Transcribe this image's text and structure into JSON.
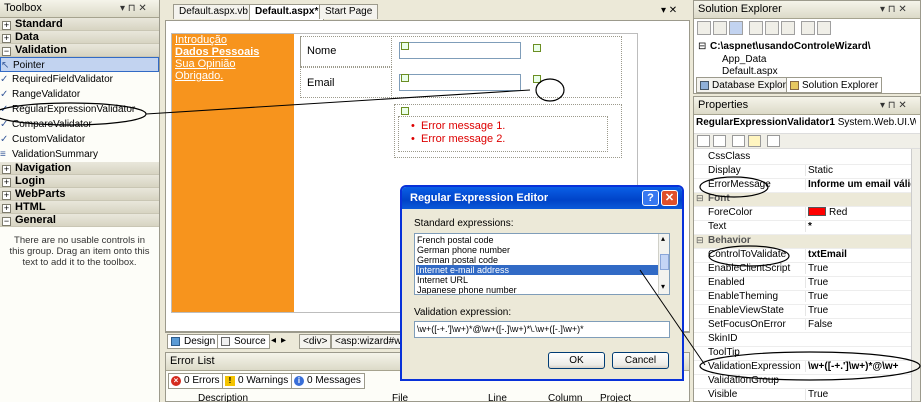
{
  "toolbox": {
    "title": "Toolbox",
    "controls": "▾ ⊓ ✕",
    "categories_top": [
      {
        "label": "Standard",
        "sign": "+"
      },
      {
        "label": "Data",
        "sign": "+"
      },
      {
        "label": "Validation",
        "sign": "−"
      }
    ],
    "validation_items": [
      {
        "label": "Pointer",
        "icon": "pointer-icon",
        "glyph": "↖"
      },
      {
        "label": "RequiredFieldValidator",
        "icon": "validator-icon",
        "glyph": "✓"
      },
      {
        "label": "RangeValidator",
        "icon": "validator-icon",
        "glyph": "✓"
      },
      {
        "label": "RegularExpressionValidator",
        "icon": "validator-icon",
        "glyph": "✓"
      },
      {
        "label": "CompareValidator",
        "icon": "validator-icon",
        "glyph": "✓"
      },
      {
        "label": "CustomValidator",
        "icon": "validator-icon",
        "glyph": "✓"
      },
      {
        "label": "ValidationSummary",
        "icon": "summary-icon",
        "glyph": "≡"
      }
    ],
    "categories_bottom": [
      {
        "label": "Navigation",
        "sign": "+"
      },
      {
        "label": "Login",
        "sign": "+"
      },
      {
        "label": "WebParts",
        "sign": "+"
      },
      {
        "label": "HTML",
        "sign": "+"
      },
      {
        "label": "General",
        "sign": "−"
      }
    ],
    "empty_message": "There are no usable controls in this group. Drag an item onto this text to add it to the toolbox."
  },
  "doc_tabs": [
    "Default.aspx.vb",
    "Default.aspx*",
    "Start Page"
  ],
  "doc_controls": "▾ ✕",
  "wizard": {
    "sidebar_links": [
      "Introdução",
      "Dados Pessoais",
      "Sua Opinião",
      "Obrigado."
    ],
    "fields": [
      "Nome",
      "Email"
    ],
    "errors": [
      "Error message 1.",
      "Error message 2."
    ]
  },
  "view_bar": {
    "design_label": "Design",
    "source_label": "Source",
    "crumbs": [
      "<div>",
      "<asp:wizard#wiz"
    ]
  },
  "error_list": {
    "title": "Error List",
    "errors_label": "0 Errors",
    "warnings_label": "0 Warnings",
    "messages_label": "0 Messages",
    "columns": [
      "Description",
      "File",
      "Line",
      "Column",
      "Project"
    ]
  },
  "solution_explorer": {
    "title": "Solution Explorer",
    "controls": "▾ ⊓ ✕",
    "tree": [
      "C:\\aspnet\\usandoControleWizard\\",
      "App_Data",
      "Default.aspx"
    ],
    "tabs": [
      "Database Explorer",
      "Solution Explorer"
    ]
  },
  "properties": {
    "title": "Properties",
    "controls": "▾ ⊓ ✕",
    "object_name": "RegularExpressionValidator1",
    "object_type": "System.Web.UI.We",
    "rows": [
      {
        "kind": "prop",
        "name": "CssClass",
        "value": ""
      },
      {
        "kind": "prop",
        "name": "Display",
        "value": "Static"
      },
      {
        "kind": "prop",
        "name": "ErrorMessage",
        "value": "Informe um email válid",
        "bold": true
      },
      {
        "kind": "cat",
        "name": "Font",
        "value": ""
      },
      {
        "kind": "prop",
        "name": "ForeColor",
        "value": "Red",
        "swatch": "#ff0000"
      },
      {
        "kind": "prop",
        "name": "Text",
        "value": "*",
        "bold": true
      },
      {
        "kind": "cat",
        "name": "Behavior",
        "value": ""
      },
      {
        "kind": "prop",
        "name": "ControlToValidate",
        "value": "txtEmail",
        "bold": true
      },
      {
        "kind": "prop",
        "name": "EnableClientScript",
        "value": "True"
      },
      {
        "kind": "prop",
        "name": "Enabled",
        "value": "True"
      },
      {
        "kind": "prop",
        "name": "EnableTheming",
        "value": "True"
      },
      {
        "kind": "prop",
        "name": "EnableViewState",
        "value": "True"
      },
      {
        "kind": "prop",
        "name": "SetFocusOnError",
        "value": "False"
      },
      {
        "kind": "prop",
        "name": "SkinID",
        "value": ""
      },
      {
        "kind": "prop",
        "name": "ToolTip",
        "value": ""
      },
      {
        "kind": "prop",
        "name": "ValidationExpression",
        "value": "\\w+([-+.']\\w+)*@\\w+",
        "bold": true
      },
      {
        "kind": "prop",
        "name": "ValidationGroup",
        "value": ""
      },
      {
        "kind": "prop",
        "name": "Visible",
        "value": "True"
      }
    ]
  },
  "dialog": {
    "title": "Regular Expression Editor",
    "help_glyph": "?",
    "close_glyph": "✕",
    "standard_label": "Standard expressions:",
    "options": [
      "French postal code",
      "German phone number",
      "German postal code",
      "Internet e-mail address",
      "Internet URL",
      "Japanese phone number"
    ],
    "selected_index": 3,
    "validation_label": "Validation expression:",
    "validation_value": "\\w+([-+.']\\w+)*@\\w+([-.]\\w+)*\\.\\w+([-.]\\w+)*",
    "ok_label": "OK",
    "cancel_label": "Cancel"
  },
  "colors": {
    "wizard_sidebar": "#f7941d",
    "selection": "#316ac5",
    "error_text": "#dd0000",
    "xp_title": "#0a5fe6"
  }
}
